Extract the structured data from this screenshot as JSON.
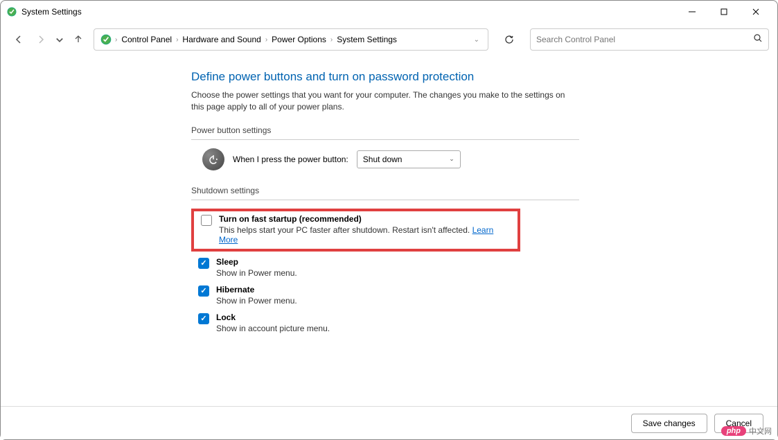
{
  "titlebar": {
    "title": "System Settings"
  },
  "breadcrumb": {
    "items": [
      "Control Panel",
      "Hardware and Sound",
      "Power Options",
      "System Settings"
    ]
  },
  "search": {
    "placeholder": "Search Control Panel"
  },
  "main": {
    "heading": "Define power buttons and turn on password protection",
    "description": "Choose the power settings that you want for your computer. The changes you make to the settings on this page apply to all of your power plans.",
    "power_section_header": "Power button settings",
    "power_label": "When I press the power button:",
    "power_value": "Shut down",
    "shutdown_section_header": "Shutdown settings",
    "fast_startup": {
      "title": "Turn on fast startup (recommended)",
      "sub": "This helps start your PC faster after shutdown. Restart isn't affected. ",
      "link": "Learn More"
    },
    "options": [
      {
        "title": "Sleep",
        "sub": "Show in Power menu."
      },
      {
        "title": "Hibernate",
        "sub": "Show in Power menu."
      },
      {
        "title": "Lock",
        "sub": "Show in account picture menu."
      }
    ]
  },
  "bottom": {
    "save": "Save changes",
    "cancel": "Cancel"
  },
  "watermark": {
    "logo": "php",
    "text": "中文网"
  }
}
